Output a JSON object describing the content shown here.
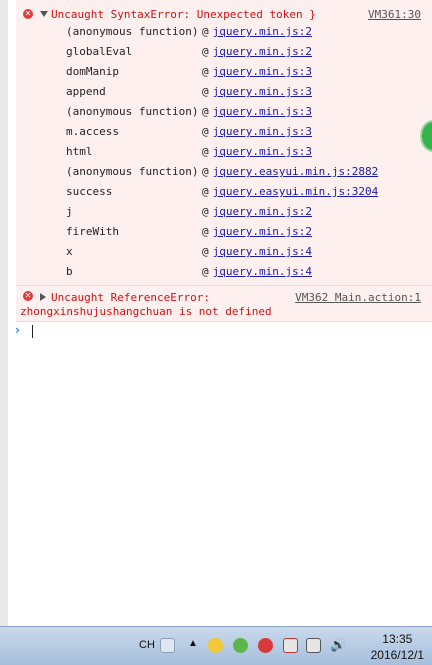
{
  "errors": [
    {
      "message": "Uncaught SyntaxError: Unexpected token }",
      "location": "VM361:30",
      "expanded": true,
      "stack": [
        {
          "fn": "(anonymous function)",
          "at": "@",
          "src": "jquery.min.js:2"
        },
        {
          "fn": "globalEval",
          "at": "@",
          "src": "jquery.min.js:2"
        },
        {
          "fn": "domManip",
          "at": "@",
          "src": "jquery.min.js:3"
        },
        {
          "fn": "append",
          "at": "@",
          "src": "jquery.min.js:3"
        },
        {
          "fn": "(anonymous function)",
          "at": "@",
          "src": "jquery.min.js:3"
        },
        {
          "fn": "m.access",
          "at": "@",
          "src": "jquery.min.js:3"
        },
        {
          "fn": "html",
          "at": "@",
          "src": "jquery.min.js:3"
        },
        {
          "fn": "(anonymous function)",
          "at": "@",
          "src": "jquery.easyui.min.js:2882"
        },
        {
          "fn": "success",
          "at": "@",
          "src": "jquery.easyui.min.js:3204"
        },
        {
          "fn": "j",
          "at": "@",
          "src": "jquery.min.js:2"
        },
        {
          "fn": "fireWith",
          "at": "@",
          "src": "jquery.min.js:2"
        },
        {
          "fn": "x",
          "at": "@",
          "src": "jquery.min.js:4"
        },
        {
          "fn": "b",
          "at": "@",
          "src": "jquery.min.js:4"
        }
      ]
    },
    {
      "message": "Uncaught ReferenceError:",
      "message_line2": "zhongxinshujushangchuan is not defined",
      "location": "VM362 Main.action:1",
      "expanded": false
    }
  ],
  "console": {
    "prompt_icon": "chevron-right-icon",
    "error_icon": "error-circle-icon"
  },
  "taskbar": {
    "ime": "CH",
    "time": "13:35",
    "date": "2016/12/1",
    "icons": [
      "keyboard-icon",
      "show-hidden-icons-icon",
      "qq-icon",
      "plus-app-icon",
      "security-icon",
      "network-blocked-icon",
      "network-icon",
      "volume-icon"
    ]
  },
  "colors": {
    "error_text": "#d31010",
    "error_bg": "#fff0f0",
    "link": "#1a1aa6",
    "prompt": "#2a7ff0"
  }
}
